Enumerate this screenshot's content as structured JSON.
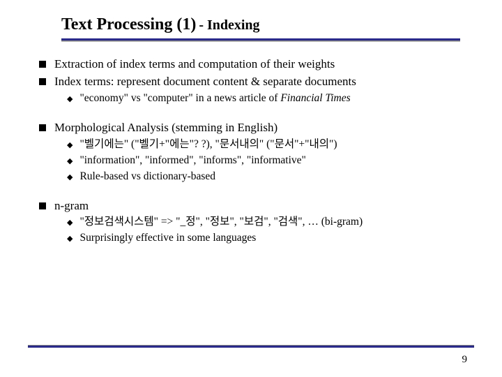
{
  "title": {
    "main": "Text Processing (1)",
    "sub": " - Indexing"
  },
  "bullets": {
    "b1": "Extraction of index terms and computation of their weights",
    "b2": "Index terms: represent document content & separate documents",
    "b2_1_pre": "\"economy\" vs \"computer\" in a news article of ",
    "b2_1_ital": "Financial Times",
    "b3": "Morphological Analysis (stemming in English)",
    "b3_1": "\"벨기에는\" (\"벨기+\"에는\"? ?), \"문서내의\" (\"문서\"+\"내의\")",
    "b3_2": "\"information\", \"informed\", \"informs\", \"informative\"",
    "b3_3": "Rule-based vs dictionary-based",
    "b4": "n-gram",
    "b4_1": "\"정보검색시스템\" => \"_정\", \"정보\", \"보검\", \"검색\", … (bi-gram)",
    "b4_2": "Surprisingly effective in some languages"
  },
  "page_number": "9"
}
